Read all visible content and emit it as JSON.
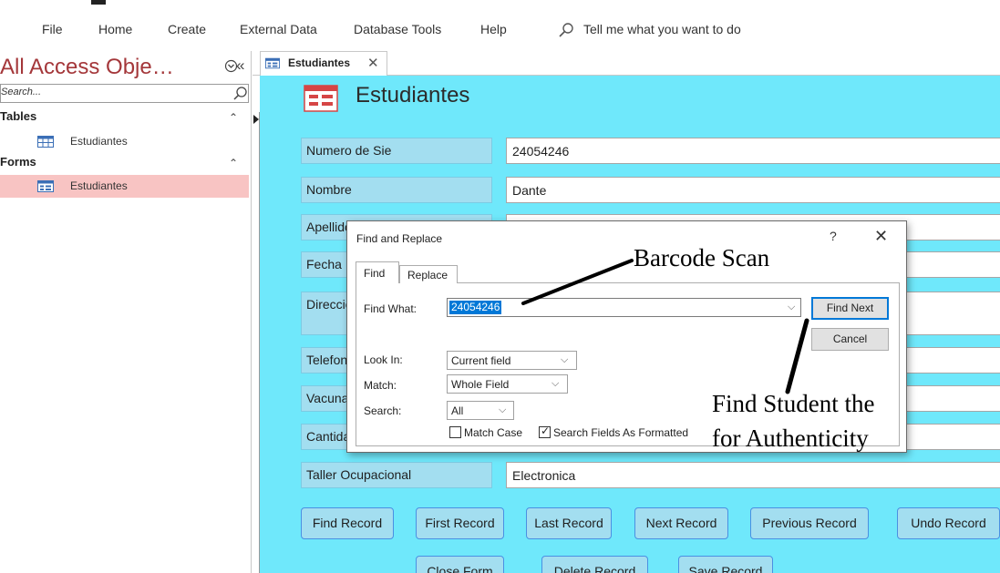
{
  "ribbon": {
    "tabs": [
      "File",
      "Home",
      "Create",
      "External Data",
      "Database Tools",
      "Help"
    ],
    "tell_me": "Tell me what you want to do"
  },
  "nav": {
    "title": "All Access Obje…",
    "search_placeholder": "Search...",
    "groups": [
      {
        "label": "Tables",
        "items": [
          "Estudiantes"
        ]
      },
      {
        "label": "Forms",
        "items": [
          "Estudiantes"
        ]
      }
    ]
  },
  "doc_tab": {
    "label": "Estudiantes"
  },
  "form": {
    "title": "Estudiantes",
    "fields": [
      {
        "label": "Numero de Sie",
        "value": "24054246"
      },
      {
        "label": "Nombre",
        "value": "Dante"
      },
      {
        "label": "Apellido",
        "value": ""
      },
      {
        "label": "Fecha",
        "value": ""
      },
      {
        "label": "Direccion",
        "value": ""
      },
      {
        "label": "Telefono",
        "value": ""
      },
      {
        "label": "Vacuna",
        "value": ""
      },
      {
        "label": "Cantidad",
        "value": ""
      },
      {
        "label": "Taller Ocupacional",
        "value": "Electronica"
      }
    ],
    "buttons_row1": [
      "Find Record",
      "First Record",
      "Last Record",
      "Next Record",
      "Previous Record",
      "Undo Record"
    ],
    "buttons_row2": [
      "Close Form",
      "Delete Record",
      "Save Record"
    ]
  },
  "dialog": {
    "title": "Find and Replace",
    "help": "?",
    "tabs": [
      "Find",
      "Replace"
    ],
    "find_what_label": "Find What:",
    "find_what_value": "24054246",
    "look_in_label": "Look In:",
    "look_in_value": "Current field",
    "match_label": "Match:",
    "match_value": "Whole Field",
    "search_label": "Search:",
    "search_value": "All",
    "match_case_label": "Match Case",
    "match_case_checked": false,
    "search_formatted_label": "Search Fields As Formatted",
    "search_formatted_checked": true,
    "find_next": "Find Next",
    "cancel": "Cancel"
  },
  "annotations": {
    "barcode": "Barcode Scan",
    "find_student_line1": "Find Student the",
    "find_student_line2": "for  Authenticity"
  },
  "colors": {
    "form_background": "#6fe8fb",
    "label_background": "#a3def0",
    "nav_title": "#a4373a",
    "nav_selected": "#f8c4c3",
    "selection": "#0078d7"
  }
}
